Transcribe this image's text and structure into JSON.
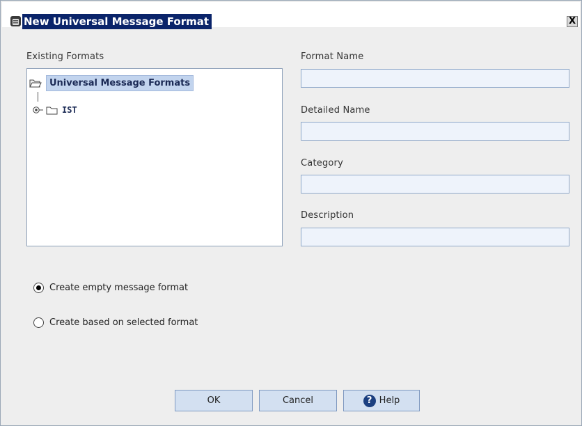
{
  "window": {
    "title": "New Universal Message Format",
    "close_glyph": "X",
    "title_icon": "app-window-icon"
  },
  "existing_formats": {
    "label": "Existing Formats",
    "tree": {
      "root_label": "Universal Message Formats",
      "children": [
        {
          "label": "IST"
        }
      ]
    }
  },
  "fields": {
    "format_name": {
      "label": "Format Name",
      "value": ""
    },
    "detailed_name": {
      "label": "Detailed Name",
      "value": ""
    },
    "category": {
      "label": "Category",
      "value": ""
    },
    "description": {
      "label": "Description",
      "value": ""
    }
  },
  "options": {
    "empty": {
      "label": "Create empty message format",
      "checked": true
    },
    "based": {
      "label": "Create based on selected format",
      "checked": false
    }
  },
  "buttons": {
    "ok": "OK",
    "cancel": "Cancel",
    "help": "Help",
    "help_glyph": "?"
  },
  "colors": {
    "title_highlight": "#0a246a",
    "tree_selection": "#c2d4ee",
    "button_face": "#d3e0f1",
    "field_bg": "#eef3fb"
  }
}
